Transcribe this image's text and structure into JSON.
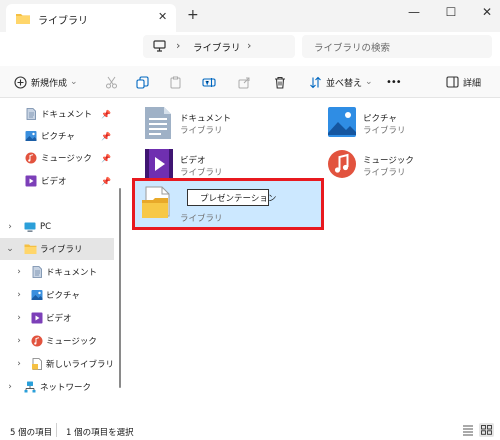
{
  "window": {
    "tab_title": "ライブラリ",
    "tab_close": "✕",
    "new_tab": "+",
    "minimize": "—",
    "maximize": "☐",
    "close": "✕"
  },
  "address": {
    "separator": "›",
    "path_label": "ライブラリ",
    "search_placeholder": "ライブラリの検索"
  },
  "toolbar": {
    "new_label": "新規作成",
    "sort_label": "並べ替え",
    "more": "•••",
    "details_label": "詳細",
    "dropdown": "⌄"
  },
  "sidebar": {
    "pinned": [
      {
        "label": "ドキュメント",
        "icon": "document-icon"
      },
      {
        "label": "ピクチャ",
        "icon": "pictures-icon"
      },
      {
        "label": "ミュージック",
        "icon": "music-icon"
      },
      {
        "label": "ビデオ",
        "icon": "video-icon"
      }
    ],
    "tree": [
      {
        "label": "PC",
        "icon": "pc-icon"
      },
      {
        "label": "ライブラリ",
        "icon": "folder-icon",
        "expanded": true,
        "selected": true
      },
      {
        "label": "ドキュメント",
        "icon": "document-icon"
      },
      {
        "label": "ピクチャ",
        "icon": "pictures-icon"
      },
      {
        "label": "ビデオ",
        "icon": "video-icon"
      },
      {
        "label": "ミュージック",
        "icon": "music-icon"
      },
      {
        "label": "新しいライブラリ",
        "icon": "new-library-icon"
      },
      {
        "label": "ネットワーク",
        "icon": "network-icon"
      }
    ],
    "chev_right": "›",
    "chev_down": "⌄",
    "pin": "📌"
  },
  "content": {
    "items": [
      {
        "name": "ドキュメント",
        "sub": "ライブラリ"
      },
      {
        "name": "ピクチャ",
        "sub": "ライブラリ"
      },
      {
        "name": "ビデオ",
        "sub": "ライブラリ"
      },
      {
        "name": "ミュージック",
        "sub": "ライブラリ"
      }
    ],
    "new_item": {
      "rename_value": "プレゼンテーション",
      "sub": "ライブラリ"
    }
  },
  "status": {
    "item_count": "5 個の項目",
    "selected_count": "1 個の項目を選択"
  },
  "colors": {
    "accent": "#0067c0",
    "selection": "#cce8ff",
    "highlight_border": "#e8191f",
    "folder": "#f5c042"
  }
}
